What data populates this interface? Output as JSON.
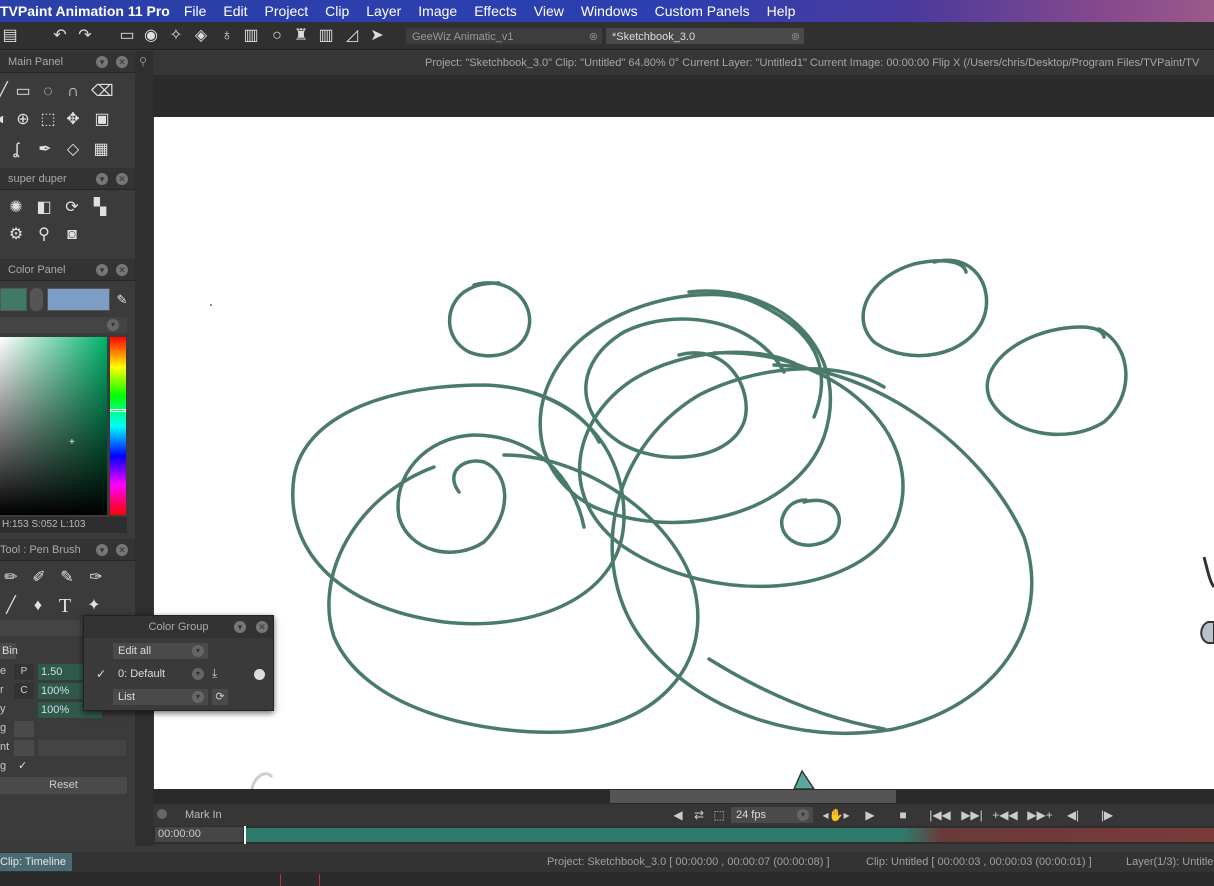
{
  "menubar": {
    "app": "TVPaint Animation 11 Pro",
    "items": [
      "File",
      "Edit",
      "Project",
      "Clip",
      "Layer",
      "Image",
      "Effects",
      "View",
      "Windows",
      "Custom Panels",
      "Help"
    ]
  },
  "toolbar": {
    "tabs": [
      {
        "label": "GeeWiz Animatic_v1",
        "close": "⊗"
      },
      {
        "label": "*Sketchbook_3.0",
        "close": "⊗"
      }
    ]
  },
  "panels": {
    "main": {
      "title": "Main Panel"
    },
    "super": {
      "title": "super duper"
    },
    "color": {
      "title": "Color Panel",
      "hsl": "H:153 S:052 L:103"
    },
    "tool": {
      "title": "Tool : Pen Brush",
      "bin": "Bin",
      "rows": [
        {
          "label": "e",
          "key": "P",
          "value": "1.50"
        },
        {
          "label": "r",
          "key": "C",
          "value": "100%"
        },
        {
          "label": "y",
          "key": "",
          "value": "100%"
        },
        {
          "label": "g",
          "key": "",
          "value": ""
        },
        {
          "label": "nt",
          "key": "",
          "value": ""
        },
        {
          "label": "g",
          "key": "",
          "value": "✓"
        }
      ],
      "reset": "Reset"
    }
  },
  "infobar": {
    "text": "Project: \"Sketchbook_3.0\"  Clip: \"Untitled\"   64.80%   0°   Current Layer: \"Untitled1\"   Current Image: 00:00:00  Flip X  (/Users/chris/Desktop/Program Files/TVPaint/TV"
  },
  "colorgroup": {
    "title": "Color Group",
    "edit_mode": "Edit all",
    "group": "0: Default",
    "view_mode": "List"
  },
  "timeline": {
    "mark_in": "Mark In",
    "fps": "24 fps",
    "time": "00:00:00"
  },
  "status": {
    "clip_tab": "Clip: Timeline",
    "project": "Project: Sketchbook_3.0 [ 00:00:00 , 00:00:07  (00:00:08) ]",
    "clip": "Clip: Untitled [ 00:00:03 , 00:00:03  (00:00:01) ]",
    "layer": "Layer(1/3): Untitle"
  },
  "colors": {
    "stroke": "#4a7a6a",
    "swatch_a": "#3f7a68",
    "swatch_b": "#7c9ec4"
  }
}
